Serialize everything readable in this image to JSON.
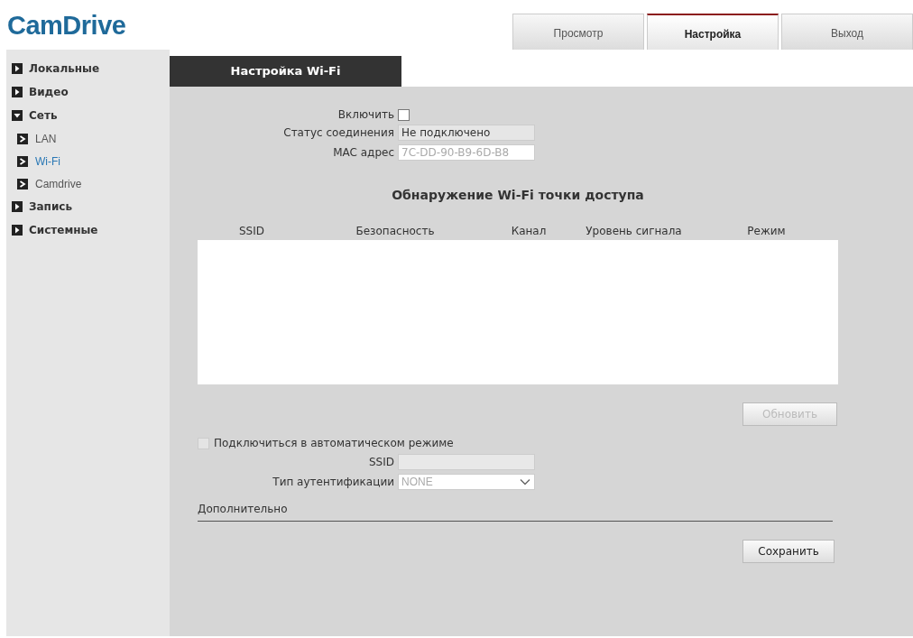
{
  "logo": "CamDrive",
  "tabs": [
    {
      "label": "Просмотр",
      "selected": false
    },
    {
      "label": "Настройка",
      "selected": true
    },
    {
      "label": "Выход",
      "selected": false
    }
  ],
  "sidebar": {
    "items": [
      {
        "label": "Локальные",
        "expanded": false
      },
      {
        "label": "Видео",
        "expanded": false
      },
      {
        "label": "Сеть",
        "expanded": true,
        "children": [
          {
            "label": "LAN",
            "selected": false
          },
          {
            "label": "Wi-Fi",
            "selected": true
          },
          {
            "label": "Camdrive",
            "selected": false
          }
        ]
      },
      {
        "label": "Запись",
        "expanded": false
      },
      {
        "label": "Системные",
        "expanded": false
      }
    ]
  },
  "panel_title": "Настройка Wi-Fi",
  "enable": {
    "label": "Включить",
    "checked": false
  },
  "status": {
    "label": "Статус соединения",
    "value": "Не подключено",
    "disabled": false
  },
  "mac": {
    "label": "MAC адрес",
    "value": "7C-DD-90-B9-6D-B8",
    "disabled": true
  },
  "scan_title": "Обнаружение Wi-Fi точки доступа",
  "table": {
    "columns": [
      "SSID",
      "Безопасность",
      "Канал",
      "Уровень сигнала",
      "Режим"
    ]
  },
  "refresh_button": {
    "label": "Обновить",
    "disabled": true
  },
  "auto_connect": {
    "label": "Подключиться в автоматическом режиме",
    "checked": false,
    "disabled": true
  },
  "ssid": {
    "label": "SSID",
    "disabled": true
  },
  "auth": {
    "label": "Тип аутентификации",
    "value": "NONE",
    "disabled": true
  },
  "section": "Дополнительно",
  "save_button": {
    "label": "Сохранить",
    "disabled": false
  }
}
